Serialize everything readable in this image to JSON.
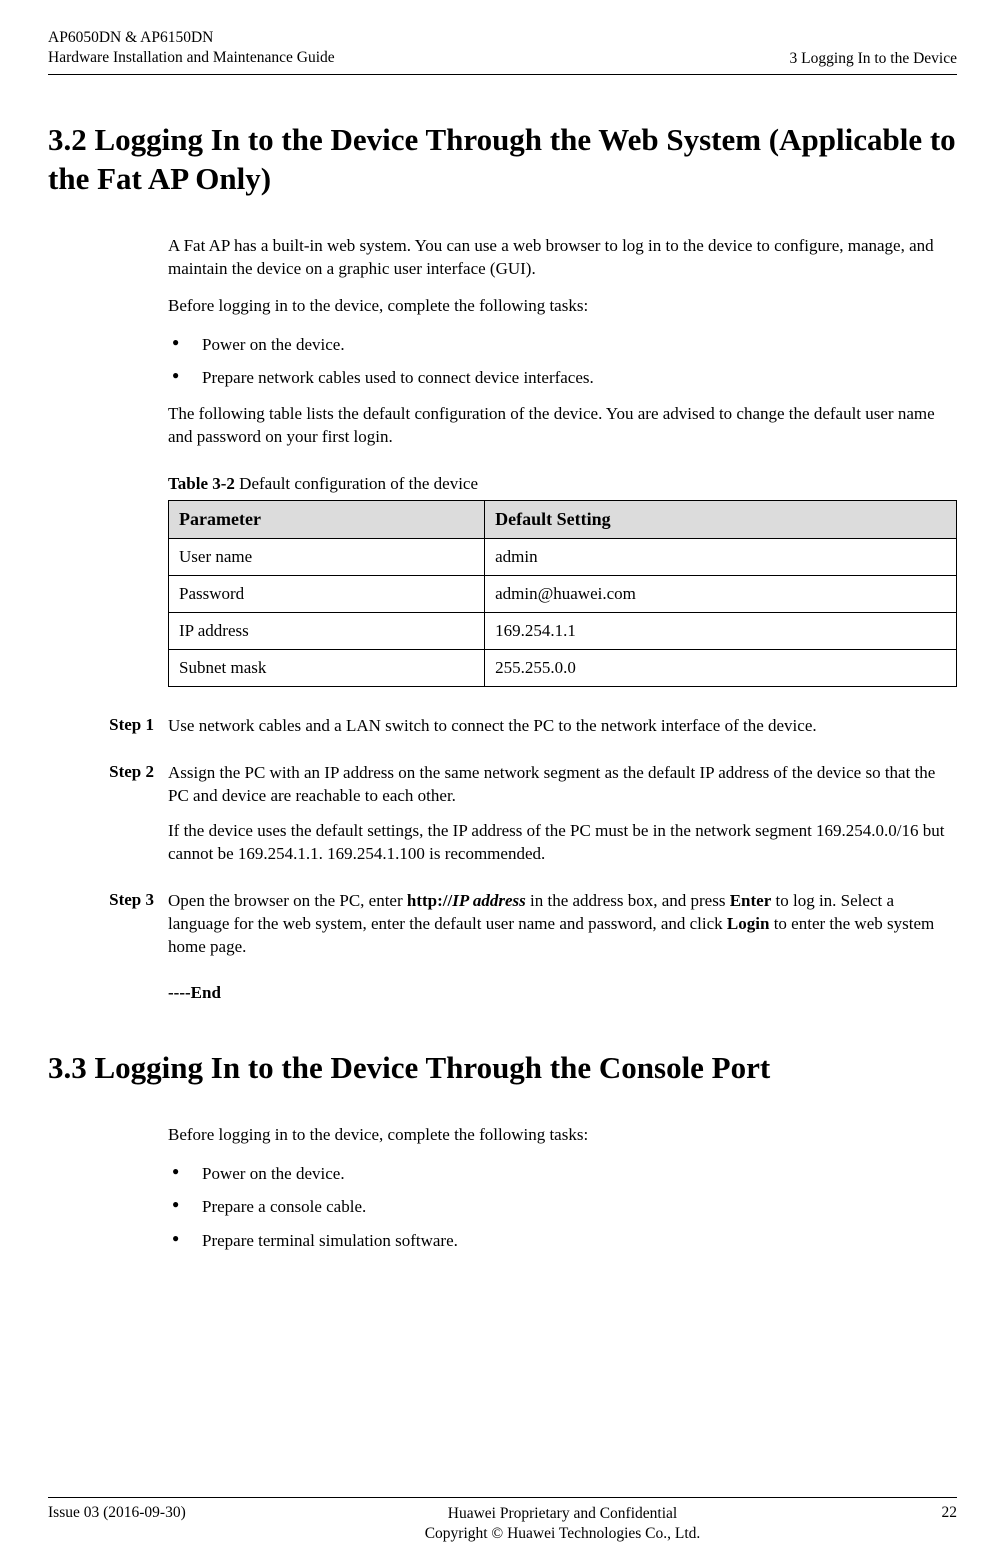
{
  "header": {
    "product": "AP6050DN & AP6150DN",
    "guide": "Hardware Installation and Maintenance Guide",
    "chapter": "3 Logging In to the Device"
  },
  "sec_3_2": {
    "title": "3.2 Logging In to the Device Through the Web System (Applicable to the Fat AP Only)",
    "p1": "A Fat AP has a built-in web system. You can use a web browser to log in to the device to configure, manage, and maintain the device on a graphic user interface (GUI).",
    "p2": "Before logging in to the device, complete the following tasks:",
    "bullets": [
      "Power on the device.",
      "Prepare network cables used to connect device interfaces."
    ],
    "p3": "The following table lists the default configuration of the device. You are advised to change the default user name and password on your first login.",
    "table_label": "Table 3-2",
    "table_caption": " Default configuration of the device",
    "table": {
      "headers": [
        "Parameter",
        "Default Setting"
      ],
      "rows": [
        [
          "User name",
          "admin"
        ],
        [
          "Password",
          "admin@huawei.com"
        ],
        [
          "IP address",
          "169.254.1.1"
        ],
        [
          "Subnet mask",
          "255.255.0.0"
        ]
      ]
    },
    "steps": [
      {
        "label": "Step 1",
        "para1": "Use network cables and a LAN switch to connect the PC to the network interface of the device."
      },
      {
        "label": "Step 2",
        "para1": "Assign the PC with an IP address on the same network segment as the default IP address of the device so that the PC and device are reachable to each other.",
        "para2": "If the device uses the default settings, the IP address of the PC must be in the network segment 169.254.0.0/16 but cannot be 169.254.1.1. 169.254.1.100 is recommended."
      },
      {
        "label": "Step 3",
        "para1_pre": "Open the browser on the PC, enter ",
        "para1_http": "http://",
        "para1_ip": "IP address",
        "para1_mid": " in the address box, and press ",
        "para1_enter": "Enter",
        "para1_post": " to log in. Select a language for the web system, enter the default user name and password, and click ",
        "para1_login": "Login",
        "para1_end": " to enter the web system home page."
      }
    ],
    "end": "----End"
  },
  "sec_3_3": {
    "title": "3.3 Logging In to the Device Through the Console Port",
    "p1": "Before logging in to the device, complete the following tasks:",
    "bullets": [
      "Power on the device.",
      "Prepare a console cable.",
      "Prepare terminal simulation software."
    ]
  },
  "footer": {
    "issue": "Issue 03 (2016-09-30)",
    "line1": "Huawei Proprietary and Confidential",
    "line2": "Copyright © Huawei Technologies Co., Ltd.",
    "page": "22"
  }
}
